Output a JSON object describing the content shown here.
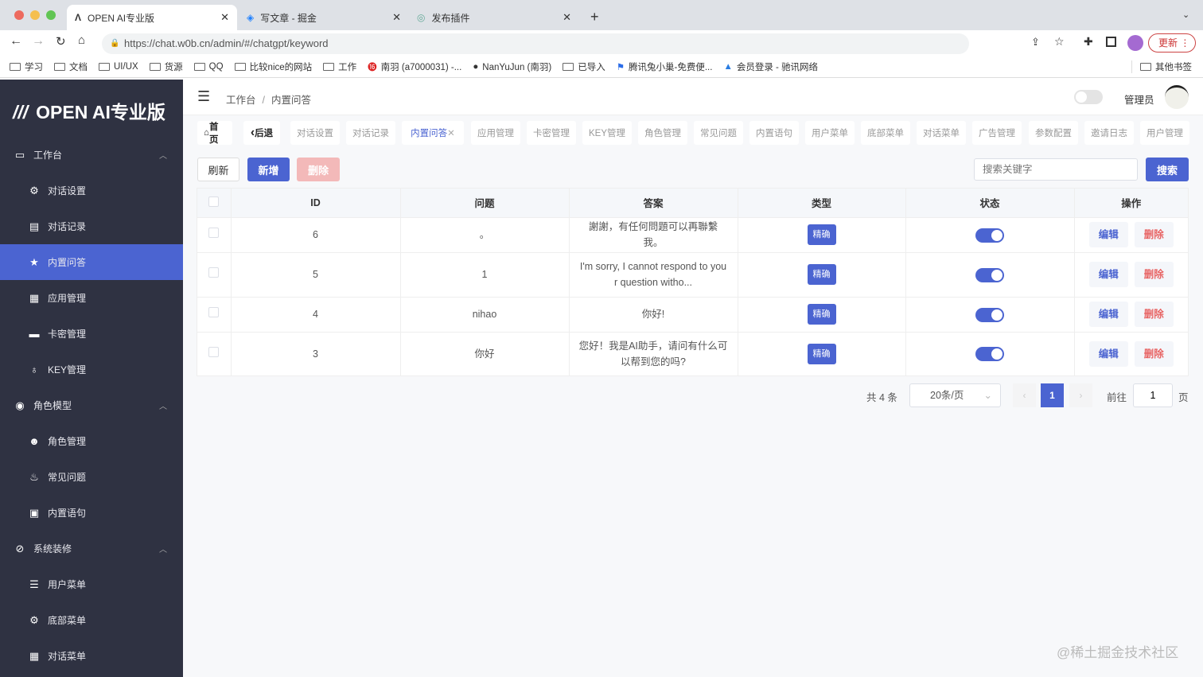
{
  "browser": {
    "tabs": [
      {
        "title": "OPEN AI专业版"
      },
      {
        "title": "写文章 - 掘金"
      },
      {
        "title": "发布插件"
      }
    ],
    "url": "https://chat.w0b.cn/admin/#/chatgpt/keyword",
    "update_label": "更新",
    "bookmarks": [
      "学习",
      "文档",
      "UI/UX",
      "货源",
      "QQ",
      "比较nice的网站",
      "工作",
      "南羽 (a7000031) -...",
      "NanYuJun (南羽)",
      "已导入",
      "腾讯兔小巢-免费便...",
      "会员登录 - 驰讯网络"
    ],
    "other_bookmarks": "其他书签"
  },
  "sidebar": {
    "logo": "OPEN AI专业版",
    "groups": [
      {
        "label": "工作台",
        "items": [
          "对话设置",
          "对话记录",
          "内置问答",
          "应用管理",
          "卡密管理",
          "KEY管理"
        ]
      },
      {
        "label": "角色模型",
        "items": [
          "角色管理",
          "常见问题",
          "内置语句"
        ]
      },
      {
        "label": "系统装修",
        "items": [
          "用户菜单",
          "底部菜单",
          "对话菜单"
        ]
      }
    ]
  },
  "header": {
    "breadcrumb": [
      "工作台",
      "内置问答"
    ],
    "user": "管理员"
  },
  "page_tabs": [
    "首页",
    "后退",
    "对话设置",
    "对话记录",
    "内置问答",
    "应用管理",
    "卡密管理",
    "KEY管理",
    "角色管理",
    "常见问题",
    "内置语句",
    "用户菜单",
    "底部菜单",
    "对话菜单",
    "广告管理",
    "参数配置",
    "邀请日志",
    "用户管理"
  ],
  "toolbar": {
    "refresh": "刷新",
    "add": "新增",
    "delete": "删除",
    "search_placeholder": "搜索关键字",
    "search": "搜索"
  },
  "table": {
    "columns": [
      "ID",
      "问题",
      "答案",
      "类型",
      "状态",
      "操作"
    ],
    "rows": [
      {
        "id": "6",
        "question": "。",
        "answer": "謝謝，有任何問題可以再聯繫我。",
        "type": "精确",
        "status": true
      },
      {
        "id": "5",
        "question": "1",
        "answer": "I'm sorry, I cannot respond to your question witho...",
        "type": "精确",
        "status": true
      },
      {
        "id": "4",
        "question": "nihao",
        "answer": "你好!",
        "type": "精确",
        "status": true
      },
      {
        "id": "3",
        "question": "你好",
        "answer": "您好！我是AI助手，请问有什么可以帮到您的吗?",
        "type": "精确",
        "status": true
      }
    ],
    "edit": "编辑",
    "delete": "删除"
  },
  "pagination": {
    "total": "共 4 条",
    "page_size": "20条/页",
    "current": "1",
    "goto": "前往",
    "goto_value": "1",
    "page_suffix": "页"
  },
  "watermark": "@稀土掘金技术社区",
  "colors": {
    "accent": "#4b64d1",
    "sidebar": "#2f3242",
    "danger": "#e86464"
  }
}
